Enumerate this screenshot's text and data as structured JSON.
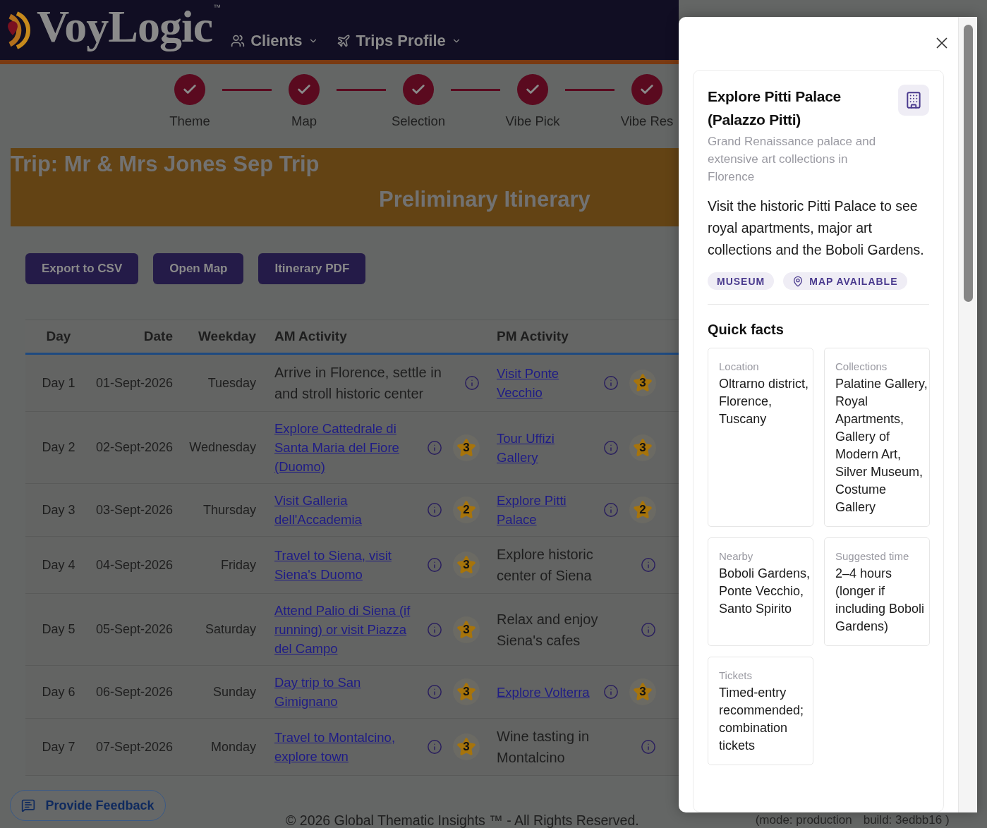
{
  "header": {
    "logo": "VoyLogic",
    "trademark": "™",
    "nav": [
      {
        "label": "Clients",
        "kind": "people"
      },
      {
        "label": "Trips Profile",
        "kind": "trips"
      }
    ]
  },
  "stepper": [
    {
      "label": "Theme",
      "done": true
    },
    {
      "label": "Map",
      "done": true
    },
    {
      "label": "Selection",
      "done": true
    },
    {
      "label": "Vibe Pick",
      "done": true
    },
    {
      "label": "Vibe Res",
      "done": true
    }
  ],
  "banner": {
    "title": "Trip: Mr & Mrs Jones Sep Trip",
    "subtitle": "Preliminary Itinerary"
  },
  "actions": [
    "Export to CSV",
    "Open Map",
    "Itinerary PDF"
  ],
  "table": {
    "columns": [
      "Day",
      "Date",
      "Weekday",
      "AM Activity",
      "PM Activity"
    ],
    "rows": [
      {
        "day": "Day 1",
        "date": "01-Sept-2026",
        "weekday": "Tuesday",
        "am": {
          "kind": "text",
          "text": "Arrive in Florence, settle in and stroll historic center"
        },
        "pm": {
          "kind": "link",
          "text": "Visit Ponte Vecchio",
          "rating": "3"
        }
      },
      {
        "day": "Day 2",
        "date": "02-Sept-2026",
        "weekday": "Wednesday",
        "am": {
          "kind": "link",
          "text": "Explore Cattedrale di Santa Maria del Fiore (Duomo)",
          "rating": "3"
        },
        "pm": {
          "kind": "link",
          "text": "Tour Uffizi Gallery",
          "rating": "3"
        }
      },
      {
        "day": "Day 3",
        "date": "03-Sept-2026",
        "weekday": "Thursday",
        "am": {
          "kind": "link",
          "text": "Visit Galleria dell'Accademia",
          "rating": "2"
        },
        "pm": {
          "kind": "link",
          "text": "Explore Pitti Palace",
          "rating": "2"
        }
      },
      {
        "day": "Day 4",
        "date": "04-Sept-2026",
        "weekday": "Friday",
        "am": {
          "kind": "link",
          "text": "Travel to Siena, visit Siena's Duomo",
          "rating": "3"
        },
        "pm": {
          "kind": "text",
          "text": "Explore historic center of Siena"
        }
      },
      {
        "day": "Day 5",
        "date": "05-Sept-2026",
        "weekday": "Saturday",
        "am": {
          "kind": "link",
          "text": "Attend Palio di Siena (if running) or visit Piazza del Campo",
          "rating": "3"
        },
        "pm": {
          "kind": "text",
          "text": "Relax and enjoy Siena's cafes"
        }
      },
      {
        "day": "Day 6",
        "date": "06-Sept-2026",
        "weekday": "Sunday",
        "am": {
          "kind": "link",
          "text": "Day trip to San Gimignano",
          "rating": "3"
        },
        "pm": {
          "kind": "link",
          "text": "Explore Volterra",
          "rating": "3"
        }
      },
      {
        "day": "Day 7",
        "date": "07-Sept-2026",
        "weekday": "Monday",
        "am": {
          "kind": "link",
          "text": "Travel to Montalcino, explore town",
          "rating": "3"
        },
        "pm": {
          "kind": "text",
          "text": "Wine tasting in Montalcino"
        }
      }
    ]
  },
  "feedback_button": "Provide Feedback",
  "footer": {
    "copyright": "© 2026 Global Thematic Insights ™ - All Rights Reserved.",
    "mode": "(mode: production",
    "build": "build: 3edbb16 )"
  },
  "detail_panel": {
    "title": "Explore Pitti Palace (Palazzo Pitti)",
    "subtitle": "Grand Renaissance palace and extensive art collections in Florence",
    "description": "Visit the historic Pitti Palace to see royal apartments, major art collections and the Boboli Gardens.",
    "tags": [
      {
        "label": "MUSEUM",
        "kind": "plain"
      },
      {
        "label": "MAP AVAILABLE",
        "kind": "map"
      }
    ],
    "quick_facts_title": "Quick facts",
    "facts": [
      {
        "label": "Location",
        "value": "Oltrarno district, Florence, Tuscany"
      },
      {
        "label": "Collections",
        "value": "Palatine Gallery, Royal Apartments, Gallery of Modern Art, Silver Museum, Costume Gallery"
      },
      {
        "label": "Nearby",
        "value": "Boboli Gardens, Ponte Vecchio, Santo Spirito"
      },
      {
        "label": "Suggested time",
        "value": "2–4 hours (longer if including Boboli Gardens)"
      },
      {
        "label": "Tickets",
        "value": "Timed-entry recommended; combination tickets"
      }
    ]
  }
}
